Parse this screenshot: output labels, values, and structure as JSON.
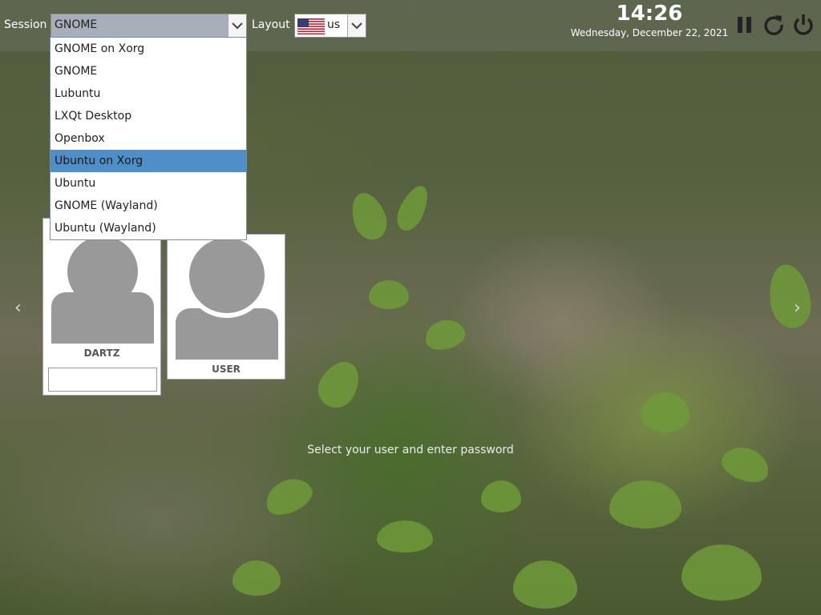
{
  "topbar": {
    "session_label": "Session",
    "session_value": "GNOME",
    "layout_label": "Layout",
    "layout_value": "us",
    "time": "14:26",
    "date": "Wednesday, December 22, 2021",
    "icons": [
      "pause-icon",
      "restart-icon",
      "power-icon"
    ]
  },
  "session_menu": {
    "items": [
      {
        "label": "GNOME on Xorg",
        "selected": false
      },
      {
        "label": "GNOME",
        "selected": false
      },
      {
        "label": "Lubuntu",
        "selected": false
      },
      {
        "label": "LXQt Desktop",
        "selected": false
      },
      {
        "label": "Openbox",
        "selected": false
      },
      {
        "label": "Ubuntu on Xorg",
        "selected": true
      },
      {
        "label": "Ubuntu",
        "selected": false
      },
      {
        "label": "GNOME (Wayland)",
        "selected": false
      },
      {
        "label": "Ubuntu (Wayland)",
        "selected": false
      }
    ]
  },
  "users": [
    {
      "name": "DARTZ",
      "active": true
    },
    {
      "name": "USER",
      "active": false
    }
  ],
  "prompt": "Select your user and enter password",
  "colors": {
    "selection": "#4f8ec6",
    "topbar": "#69705f"
  }
}
